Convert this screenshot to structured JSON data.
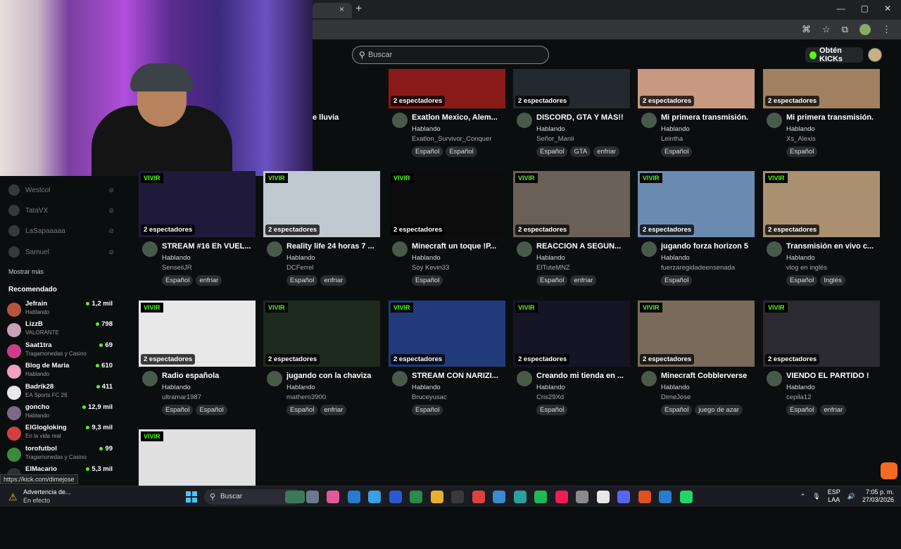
{
  "browser": {
    "tab_close": "×",
    "new_tab": "+",
    "win_min": "—",
    "win_max": "▢",
    "win_close": "✕"
  },
  "header": {
    "search_placeholder": "Buscar",
    "kicks_button": "Obtén KICKs"
  },
  "sidebar": {
    "followed": [
      {
        "name": "Westcol"
      },
      {
        "name": "TataVX"
      },
      {
        "name": "LaSapaaaaa"
      },
      {
        "name": "Samuel"
      }
    ],
    "show_more": "Mostrar más",
    "recommended_title": "Recomendado",
    "recommended": [
      {
        "name": "Jefraín",
        "category": "Hablando",
        "viewers": "1,2 mil",
        "color": "#b8553a"
      },
      {
        "name": "LizzB",
        "category": "VALORANTE",
        "viewers": "798",
        "color": "#c8a0b8"
      },
      {
        "name": "Saat1tra",
        "category": "Tragamonedas y Casino",
        "viewers": "69",
        "color": "#d03c8a"
      },
      {
        "name": "Blog de Maria",
        "category": "Hablando",
        "viewers": "610",
        "color": "#f2a0c0"
      },
      {
        "name": "Badrik28",
        "category": "EA Sports FC 26",
        "viewers": "411",
        "color": "#e8e8e8"
      },
      {
        "name": "goncho",
        "category": "Hablando",
        "viewers": "12,9 mil",
        "color": "#7a6a8a"
      },
      {
        "name": "ElGlogloking",
        "category": "En la vida real",
        "viewers": "9,3 mil",
        "color": "#d04040"
      },
      {
        "name": "torofutbol",
        "category": "Tragamonedas y Casino",
        "viewers": "99",
        "color": "#3a8a3a"
      },
      {
        "name": "ElMacario",
        "category": "",
        "viewers": "5,3 mil",
        "color": "#303030"
      }
    ]
  },
  "labels": {
    "live": "VIVIR",
    "viewers": "2 espectadores"
  },
  "cards_top": [
    {
      "title": "e lluvia",
      "category": "",
      "streamer": "o",
      "tags": [],
      "color": "#4a6a8a"
    },
    {
      "title": "Exatlon Mexico, Alem...",
      "category": "Hablando",
      "streamer": "Exatlon_Survivor_Conquer",
      "tags": [
        "Español",
        "Español"
      ],
      "color": "#8a1a1a"
    },
    {
      "title": "DISCORD, GTA Y MÁS!!",
      "category": "Hablando",
      "streamer": "Señor_Manii",
      "tags": [
        "Español",
        "GTA",
        "enfriar"
      ],
      "color": "#222a30"
    },
    {
      "title": "Mi primera transmisión.",
      "category": "Hablando",
      "streamer": "Leintha",
      "tags": [
        "Español"
      ],
      "color": "#c89880"
    },
    {
      "title": "Mi primera transmisión.",
      "category": "Hablando",
      "streamer": "Xs_Alexis",
      "tags": [
        "Español"
      ],
      "color": "#a08060"
    }
  ],
  "cards": [
    {
      "title": "STREAM #16 Eh VUEL...",
      "category": "Hablando",
      "streamer": "SenseiiJR",
      "tags": [
        "Español",
        "enfriar"
      ],
      "color": "#1f1a3a"
    },
    {
      "title": "Reality life 24 horas 7 ...",
      "category": "Hablando",
      "streamer": "DCFerrel",
      "tags": [
        "Español",
        "enfriar"
      ],
      "color": "#c0c8d0"
    },
    {
      "title": "Minecraft un toque !P...",
      "category": "Hablando",
      "streamer": "Soy Kevin33",
      "tags": [
        "Español"
      ],
      "color": "#0c0c0c"
    },
    {
      "title": "REACCION A SEGUN...",
      "category": "Hablando",
      "streamer": "ElTuteMNZ",
      "tags": [
        "Español",
        "enfriar"
      ],
      "color": "#6a6058"
    },
    {
      "title": "jugando forza horizon 5",
      "category": "Hablando",
      "streamer": "fuerzaregidadeensenada",
      "tags": [
        "Español"
      ],
      "color": "#6a8ab0"
    },
    {
      "title": "Transmisión en vivo c...",
      "category": "Hablando",
      "streamer": "vlog en inglés",
      "tags": [
        "Español",
        "Inglés"
      ],
      "color": "#a89070"
    },
    {
      "title": "Radio española",
      "category": "Hablando",
      "streamer": "ultramar1987",
      "tags": [
        "Español",
        "Español"
      ],
      "color": "#e8e8e8"
    },
    {
      "title": "jugando con la chaviza",
      "category": "Hablando",
      "streamer": "mathero3900",
      "tags": [
        "Español",
        "enfriar"
      ],
      "color": "#1e2a1e"
    },
    {
      "title": "STREAM CON NARIZI...",
      "category": "Hablando",
      "streamer": "Bruceyusac",
      "tags": [
        "Español"
      ],
      "color": "#203a7a"
    },
    {
      "title": "Creando mi tienda en ...",
      "category": "Hablando",
      "streamer": "Cris29Xd",
      "tags": [
        "Español"
      ],
      "color": "#151525"
    },
    {
      "title": "Minecraft Cobblerverse",
      "category": "Hablando",
      "streamer": "DimeJose",
      "tags": [
        "Español",
        "juego de azar"
      ],
      "color": "#7a6a5a"
    },
    {
      "title": "VIENDO EL PARTIDO !",
      "category": "Hablando",
      "streamer": "cepila12",
      "tags": [
        "Español",
        "enfriar"
      ],
      "color": "#2a2a30"
    },
    {
      "title": "",
      "category": "",
      "streamer": "",
      "tags": [],
      "color": "#e0e0e0"
    }
  ],
  "status_url": "https://kick.com/dimejose",
  "taskbar": {
    "warning_title": "Advertencia de...",
    "warning_sub": "En efecto",
    "search": "Buscar",
    "lang_top": "ESP",
    "lang_bottom": "LAA",
    "time": "7:05 p. m.",
    "date": "27/03/2026"
  }
}
